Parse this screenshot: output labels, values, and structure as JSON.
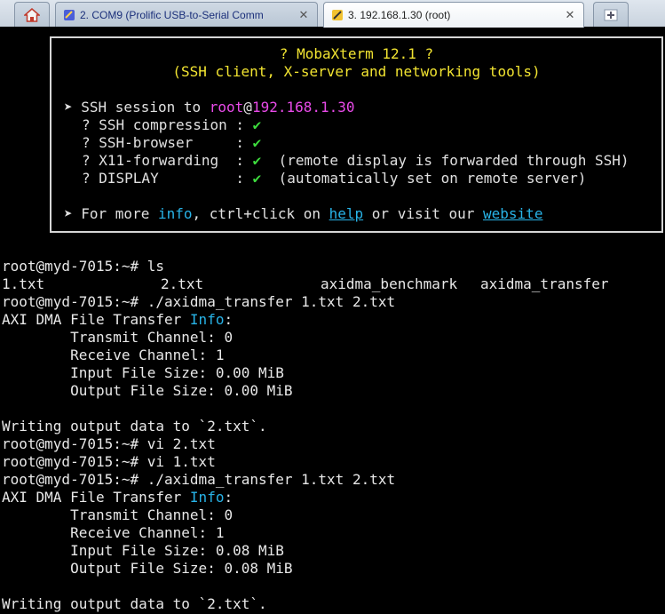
{
  "tabs": {
    "home_icon": "home-icon",
    "com9": {
      "label": "2. COM9  (Prolific USB-to-Serial Comm",
      "close": "✕"
    },
    "ssh": {
      "label": "3. 192.168.1.30 (root)",
      "close": "✕"
    },
    "new_tab_icon": "plus-icon"
  },
  "banner": {
    "title": "? MobaXterm 12.1 ?",
    "subtitle": "(SSH client, X-server and networking tools)",
    "session_prefix": "➤ SSH session to ",
    "session_user": "root",
    "session_at": "@",
    "session_host": "192.168.1.30",
    "features": [
      {
        "label": "? SSH compression : ",
        "check": "✔",
        "note": ""
      },
      {
        "label": "? SSH-browser     : ",
        "check": "✔",
        "note": ""
      },
      {
        "label": "? X11-forwarding  : ",
        "check": "✔",
        "note": "  (remote display is forwarded through SSH)"
      },
      {
        "label": "? DISPLAY         : ",
        "check": "✔",
        "note": "  (automatically set on remote server)"
      }
    ],
    "more_prefix": "➤ For more ",
    "more_info": "info",
    "more_mid": ", ctrl+click on ",
    "more_help": "help",
    "more_or": " or visit our ",
    "more_website": "website"
  },
  "terminal": {
    "prompt1": "root@myd-7015:~# ls",
    "ls_files": [
      "1.txt",
      "2.txt",
      "axidma_benchmark",
      "axidma_transfer"
    ],
    "prompt2": "root@myd-7015:~# ./axidma_transfer 1.txt 2.txt",
    "run1": {
      "header_prefix": "AXI DMA File Transfer ",
      "header_info": "Info",
      "header_suffix": ":",
      "tx": "        Transmit Channel: 0",
      "rx": "        Receive Channel: 1",
      "in": "        Input File Size: 0.00 MiB",
      "out": "        Output File Size: 0.00 MiB"
    },
    "writing1": "Writing output data to `2.txt`.",
    "prompt3": "root@myd-7015:~# vi 2.txt",
    "prompt4": "root@myd-7015:~# vi 1.txt",
    "prompt5": "root@myd-7015:~# ./axidma_transfer 1.txt 2.txt",
    "run2": {
      "header_prefix": "AXI DMA File Transfer ",
      "header_info": "Info",
      "header_suffix": ":",
      "tx": "        Transmit Channel: 0",
      "rx": "        Receive Channel: 1",
      "in": "        Input File Size: 0.08 MiB",
      "out": "        Output File Size: 0.08 MiB"
    },
    "writing2": "Writing output data to `2.txt`."
  }
}
